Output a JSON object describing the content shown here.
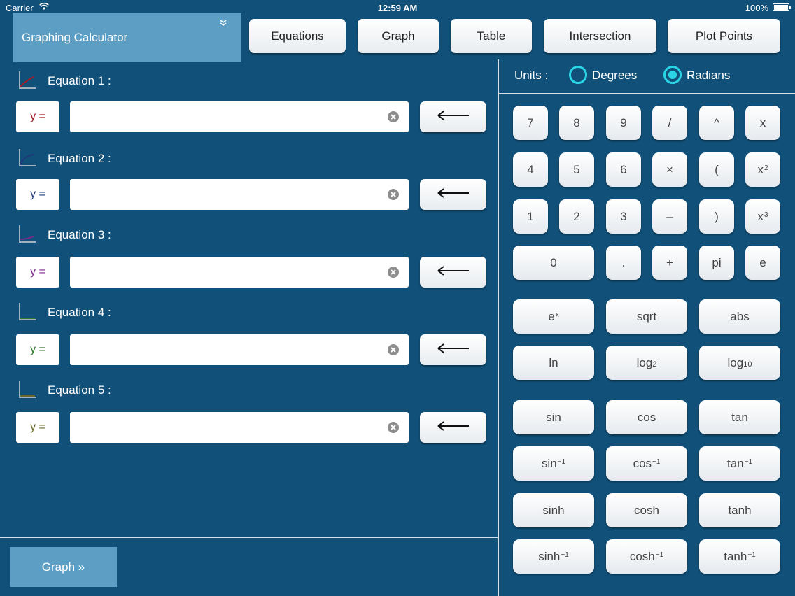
{
  "status_bar": {
    "carrier": "Carrier",
    "time": "12:59 AM",
    "battery": "100%"
  },
  "header": {
    "title": "Graphing Calculator"
  },
  "tabs": [
    "Equations",
    "Graph",
    "Table",
    "Intersection",
    "Plot Points"
  ],
  "equations": [
    {
      "label": "Equation 1 :",
      "prefix": "y =",
      "color": "#a01e28",
      "value": ""
    },
    {
      "label": "Equation 2 :",
      "prefix": "y =",
      "color": "#1e3a7a",
      "value": ""
    },
    {
      "label": "Equation 3 :",
      "prefix": "y =",
      "color": "#7a2a8a",
      "value": ""
    },
    {
      "label": "Equation 4 :",
      "prefix": "y =",
      "color": "#2f7a2a",
      "value": ""
    },
    {
      "label": "Equation 5 :",
      "prefix": "y =",
      "color": "#6a6a28",
      "value": ""
    }
  ],
  "units": {
    "label": "Units :",
    "options": [
      "Degrees",
      "Radians"
    ],
    "selected": "Radians"
  },
  "keypad": {
    "row1": [
      "7",
      "8",
      "9",
      "/",
      "^",
      "x"
    ],
    "row2": [
      "4",
      "5",
      "6",
      "×",
      "(",
      "x",
      "2"
    ],
    "row3": [
      "1",
      "2",
      "3",
      "–",
      ")",
      "x",
      "3"
    ],
    "row4": [
      "0",
      ".",
      "+",
      "pi",
      "e"
    ],
    "exp": {
      "base": "e",
      "sup": "x"
    },
    "sqrt": "sqrt",
    "abs": "abs",
    "ln": "ln",
    "log2": {
      "base": "log",
      "sub": "2"
    },
    "log10": {
      "base": "log",
      "sub": "10"
    },
    "trig": [
      "sin",
      "cos",
      "tan"
    ],
    "inv_trig": [
      "sin",
      "cos",
      "tan"
    ],
    "inv_sup": "−1",
    "hyp": [
      "sinh",
      "cosh",
      "tanh"
    ],
    "inv_hyp": [
      "sinh",
      "cosh",
      "tanh"
    ]
  },
  "graph_button": "Graph »",
  "accent_colors": {
    "background": "#115079",
    "panel": "#5d9fc4",
    "radio": "#2ad6e6"
  }
}
